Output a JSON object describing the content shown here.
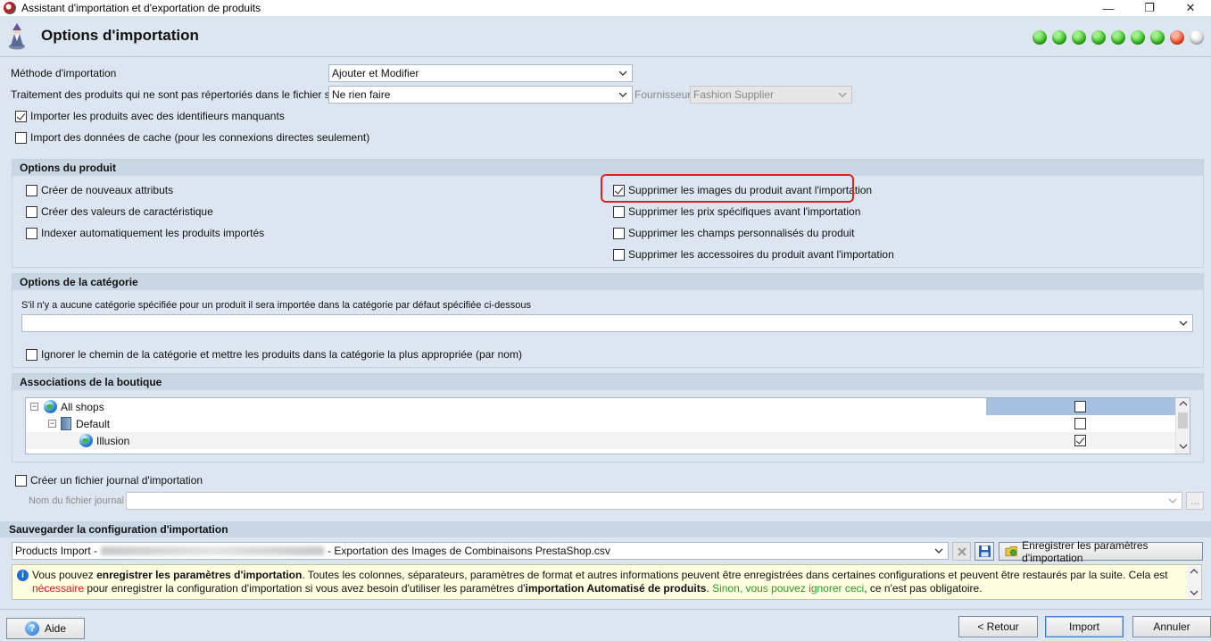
{
  "window": {
    "title": "Assistant d'importation et d'exportation de produits",
    "minimize": "—",
    "maximize": "❐",
    "close": "✕"
  },
  "header": {
    "title": "Options d'importation",
    "steps": [
      "green",
      "green",
      "green",
      "green",
      "green",
      "green",
      "green",
      "red",
      "gray"
    ]
  },
  "import": {
    "method_label": "Méthode d'importation",
    "method_value": "Ajouter et Modifier",
    "untracked_label": "Traitement des produits qui ne sont pas répertoriés dans le fichier source",
    "untracked_value": "Ne rien faire",
    "supplier_label": "Fournisseur",
    "supplier_value": "Fashion Supplier",
    "missing_ids": "Importer les produits avec des identifieurs manquants",
    "cache": "Import des données de cache (pour les connexions directes seulement)"
  },
  "product_options": {
    "header": "Options du produit",
    "create_attributes": "Créer de nouveaux attributs",
    "create_feature_values": "Créer des valeurs de caractéristique",
    "auto_index": "Indexer automatiquement les produits importés",
    "delete_images": "Supprimer les images du produit avant l'importation",
    "delete_specific_prices": "Supprimer les prix spécifiques avant l'importation",
    "delete_custom_fields": "Supprimer les champs personnalisés du produit",
    "delete_accessories": "Supprimer les accessoires du produit avant l'importation"
  },
  "category_options": {
    "header": "Options de la catégorie",
    "description": "S'il n'y a aucune catégorie spécifiée pour un produit il sera importée dans la catégorie par défaut spécifiée ci-dessous",
    "default_category_value": "",
    "ignore_path": "Ignorer le chemin de la catégorie et mettre les produits dans la catégorie la plus appropriée (par nom)"
  },
  "shop_associations": {
    "header": "Associations de la boutique",
    "nodes": [
      "All shops",
      "Default",
      "Illusion"
    ]
  },
  "log": {
    "create_log": "Créer un fichier journal d'importation",
    "filename_label": "Nom du fichier journal",
    "filename_value": "",
    "browse": "..."
  },
  "save_config": {
    "header": "Sauvegarder la configuration d'importation",
    "config_prefix": "Products Import -",
    "config_suffix": "- Exportation des Images de Combinaisons PrestaShop.csv",
    "save_button": "Enregistrer les paramètres d'importation"
  },
  "info": {
    "p1": "Vous pouvez ",
    "b1": "enregistrer les paramètres d'importation",
    "p2": ". Toutes les colonnes, séparateurs, paramètres de format et autres informations peuvent être enregistrées dans certaines configurations et peuvent être restaurés par la suite. Cela est ",
    "red": "nécessaire",
    "p3": " pour enregistrer la configuration d'importation si vous avez besoin d'utiliser les paramètres d'",
    "b2": "importation Automatisé de produits",
    "p4": ". ",
    "green": "Sinon, vous pouvez ignorer ceci",
    "p5": ", ce n'est pas obligatoire."
  },
  "footer": {
    "help": "Aide",
    "back": "< Retour",
    "import": "Import",
    "cancel": "Annuler"
  }
}
